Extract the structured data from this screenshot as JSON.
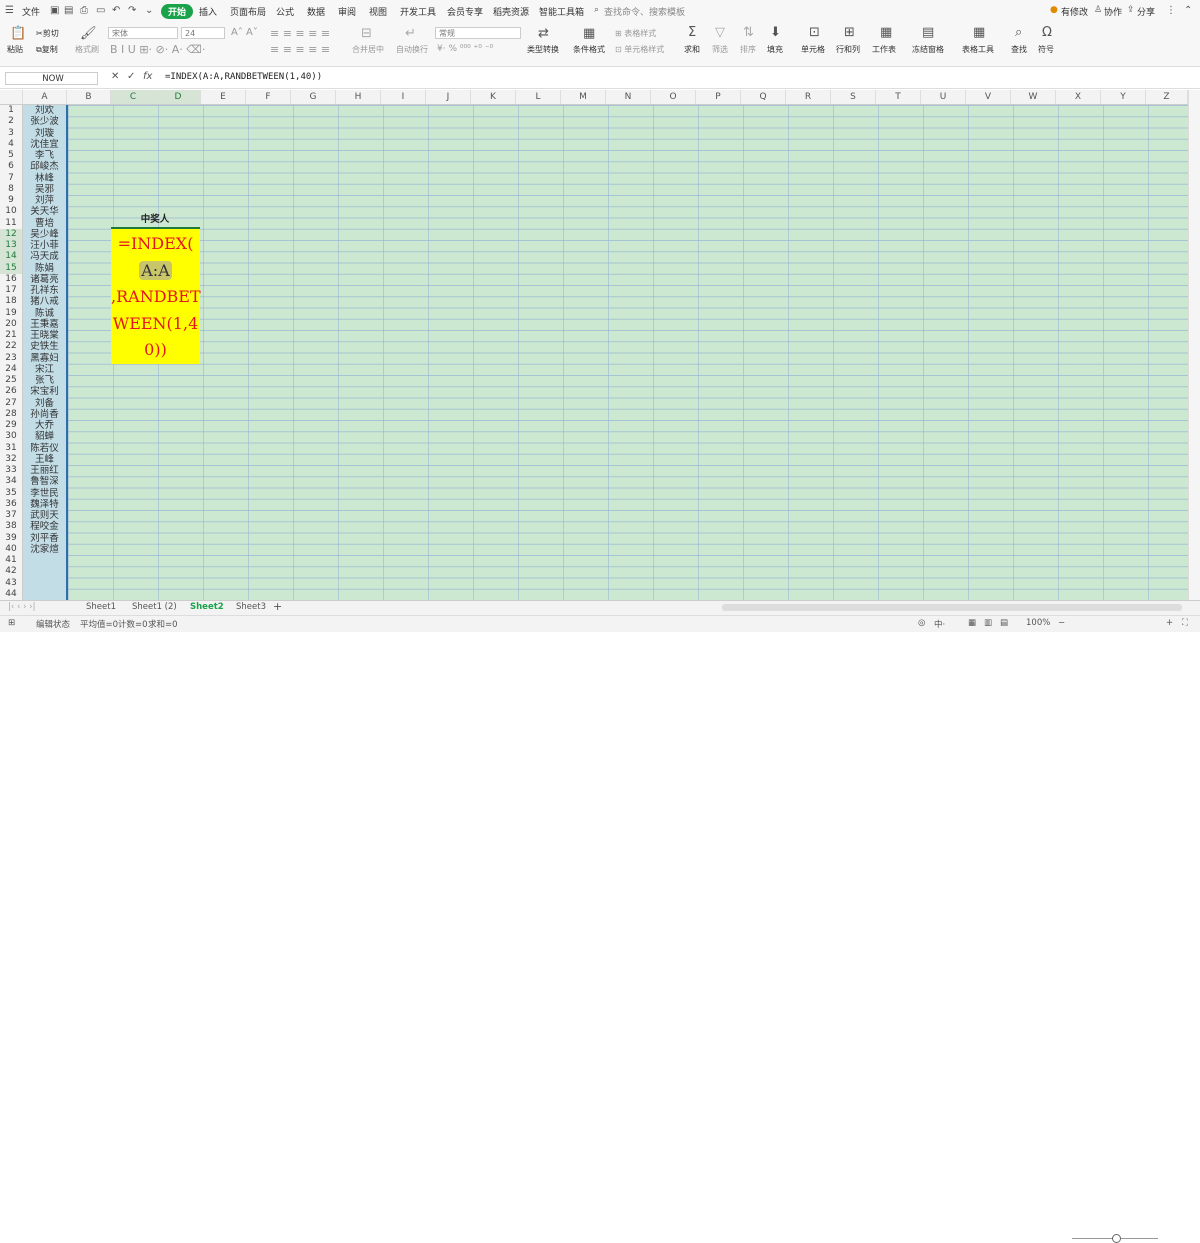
{
  "menubar": {
    "file": "文件",
    "tabs": [
      "开始",
      "插入",
      "页面布局",
      "公式",
      "数据",
      "审阅",
      "视图",
      "开发工具",
      "会员专享",
      "稻壳资源",
      "智能工具箱"
    ],
    "active_tab": "开始",
    "search_placeholder": "查找命令、搜索模板",
    "right": {
      "edit": "有修改",
      "collab": "协作",
      "share": "分享"
    }
  },
  "ribbon": {
    "paste": "粘贴",
    "cut": "剪切",
    "copy": "复制",
    "format_painter": "格式刷",
    "font_name": "宋体",
    "font_size": "24",
    "merge": "合并居中",
    "wrap": "自动换行",
    "number_format": "常规",
    "type_convert": "类型转换",
    "cond_format": "条件格式",
    "table_style": "表格样式",
    "cell_style": "单元格样式",
    "sum": "求和",
    "filter": "筛选",
    "sort": "排序",
    "fill": "填充",
    "cell": "单元格",
    "rowcol": "行和列",
    "worksheet": "工作表",
    "freeze": "冻结窗格",
    "table_tools": "表格工具",
    "find": "查找",
    "symbol": "符号"
  },
  "formula_bar": {
    "name_box": "NOW",
    "formula": "=INDEX(A:A,RANDBETWEEN(1,40))"
  },
  "columns": [
    "A",
    "B",
    "C",
    "D",
    "E",
    "F",
    "G",
    "H",
    "I",
    "J",
    "K",
    "L",
    "M",
    "N",
    "O",
    "P",
    "Q",
    "R",
    "S",
    "T",
    "U",
    "V",
    "W",
    "X",
    "Y",
    "Z"
  ],
  "rows": [
    "1",
    "2",
    "3",
    "4",
    "5",
    "6",
    "7",
    "8",
    "9",
    "10",
    "11",
    "12",
    "13",
    "14",
    "15",
    "16",
    "17",
    "18",
    "19",
    "20",
    "21",
    "22",
    "23",
    "24",
    "25",
    "26",
    "27",
    "28",
    "29",
    "30",
    "31",
    "32",
    "33",
    "34",
    "35",
    "36",
    "37",
    "38",
    "39",
    "40",
    "41",
    "42",
    "43",
    "44"
  ],
  "names": [
    "刘欢",
    "张少波",
    "刘璇",
    "沈佳宜",
    "李飞",
    "邱峻杰",
    "林峰",
    "吴邪",
    "刘萍",
    "关天华",
    "曹培",
    "吴少峰",
    "汪小菲",
    "冯天成",
    "陈娟",
    "诸葛亮",
    "孔祥东",
    "猪八戒",
    "陈诚",
    "王秉嘉",
    "王晓棠",
    "史铁生",
    "黑寡妇",
    "宋江",
    "张飞",
    "宋宝利",
    "刘备",
    "孙尚香",
    "大乔",
    "貂蝉",
    "陈若仪",
    "王峰",
    "王丽红",
    "鲁智深",
    "李世民",
    "魏泽特",
    "武则天",
    "程咬金",
    "刘平香",
    "沈家煊"
  ],
  "winner_label": "中奖人",
  "formula_cell_lines": [
    "=INDEX(",
    "A:A",
    ",RANDBET",
    "WEEN(1,4",
    "0))"
  ],
  "sheets": [
    "Sheet1",
    "Sheet1 (2)",
    "Sheet2",
    "Sheet3"
  ],
  "active_sheet": "Sheet2",
  "status": {
    "mode": "编辑状态",
    "average": "平均值=0",
    "count": "计数=0",
    "sum": "求和=0",
    "zoom": "100%"
  }
}
